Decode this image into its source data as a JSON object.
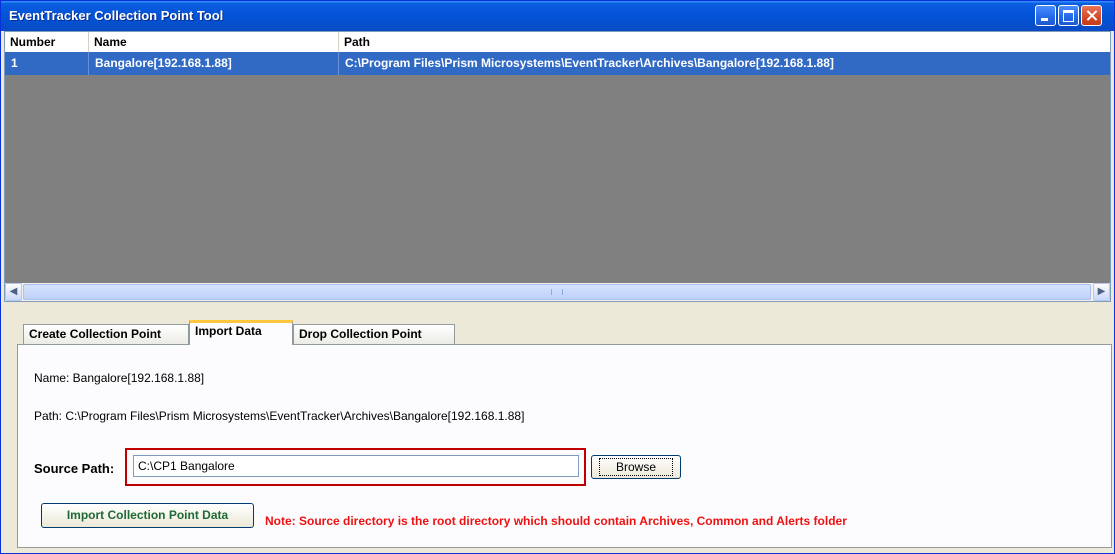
{
  "window": {
    "title": "EventTracker Collection Point Tool"
  },
  "grid": {
    "columns": [
      "Number",
      "Name",
      "Path"
    ],
    "rows": [
      {
        "number": "1",
        "name": "Bangalore[192.168.1.88]",
        "path": "C:\\Program Files\\Prism Microsystems\\EventTracker\\Archives\\Bangalore[192.168.1.88]"
      }
    ]
  },
  "tabs": [
    {
      "label": "Create Collection Point"
    },
    {
      "label": "Import Data"
    },
    {
      "label": "Drop Collection Point"
    }
  ],
  "active_tab": "Import Data",
  "import": {
    "name_line": "Name: Bangalore[192.168.1.88]",
    "path_line": "Path: C:\\Program Files\\Prism Microsystems\\EventTracker\\Archives\\Bangalore[192.168.1.88]",
    "source_label": "Source Path:",
    "source_value": "C:\\CP1 Bangalore",
    "browse_label": "Browse",
    "import_button_label": "Import Collection Point Data",
    "note": "Note: Source directory is the root directory which should contain Archives, Common and Alerts folder"
  },
  "colors": {
    "titlebar": "#0553d8",
    "selection": "#316ac5",
    "highlight_border": "#c00000",
    "note_text": "#ee1111",
    "import_button_text": "#1e6a34"
  }
}
